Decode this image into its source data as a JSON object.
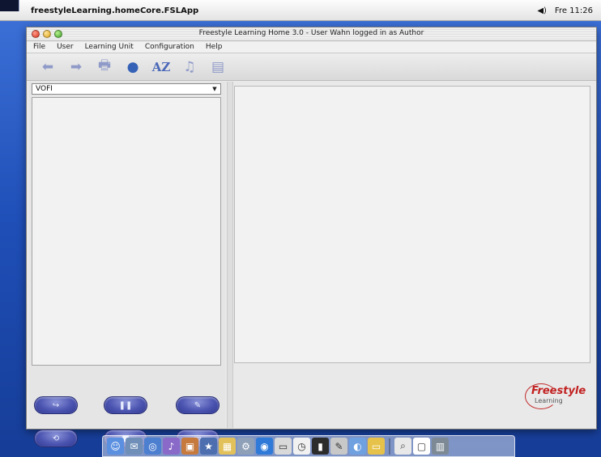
{
  "system_menubar": {
    "app_name": "freestyleLearning.homeCore.FSLApp",
    "volume_glyph": "◀)",
    "clock": "Fre 11:26"
  },
  "window": {
    "title": "Freestyle Learning Home 3.0 - User Wahn logged in as Author",
    "menu": [
      "File",
      "User",
      "Learning Unit",
      "Configuration",
      "Help"
    ]
  },
  "toolbar": {
    "icons": [
      "back-arrow-icon",
      "forward-arrow-icon",
      "print-icon",
      "globe-icon",
      "az-icon",
      "music-icon",
      "document-icon"
    ],
    "glyphs": {
      "back": "⬅",
      "forward": "➡",
      "print": "🖶",
      "globe": "●",
      "az": "AZ",
      "music": "♫",
      "document": "▤"
    }
  },
  "left_pane": {
    "selected_unit": "VOFI",
    "buttons": [
      {
        "name": "forward-button",
        "glyph": "↪"
      },
      {
        "name": "pause-button",
        "glyph": "❚❚"
      },
      {
        "name": "edit-button",
        "glyph": "✎"
      },
      {
        "name": "loop-button",
        "glyph": "⟲"
      },
      {
        "name": "stop-button",
        "glyph": "■"
      },
      {
        "name": "present-button",
        "glyph": "▭"
      }
    ]
  },
  "branding": {
    "logo_word": "Freestyle",
    "logo_sub": "Learning",
    "accent_color": "#c22222"
  },
  "dock": {
    "items": [
      "finder",
      "mail",
      "safari",
      "itunes",
      "iphoto",
      "imovie",
      "ical",
      "system-prefs",
      "terminal",
      "preview",
      "clock",
      "terminal-dark",
      "textedit",
      "address-book",
      "folder",
      "spotlight",
      "blank",
      "trash"
    ]
  }
}
